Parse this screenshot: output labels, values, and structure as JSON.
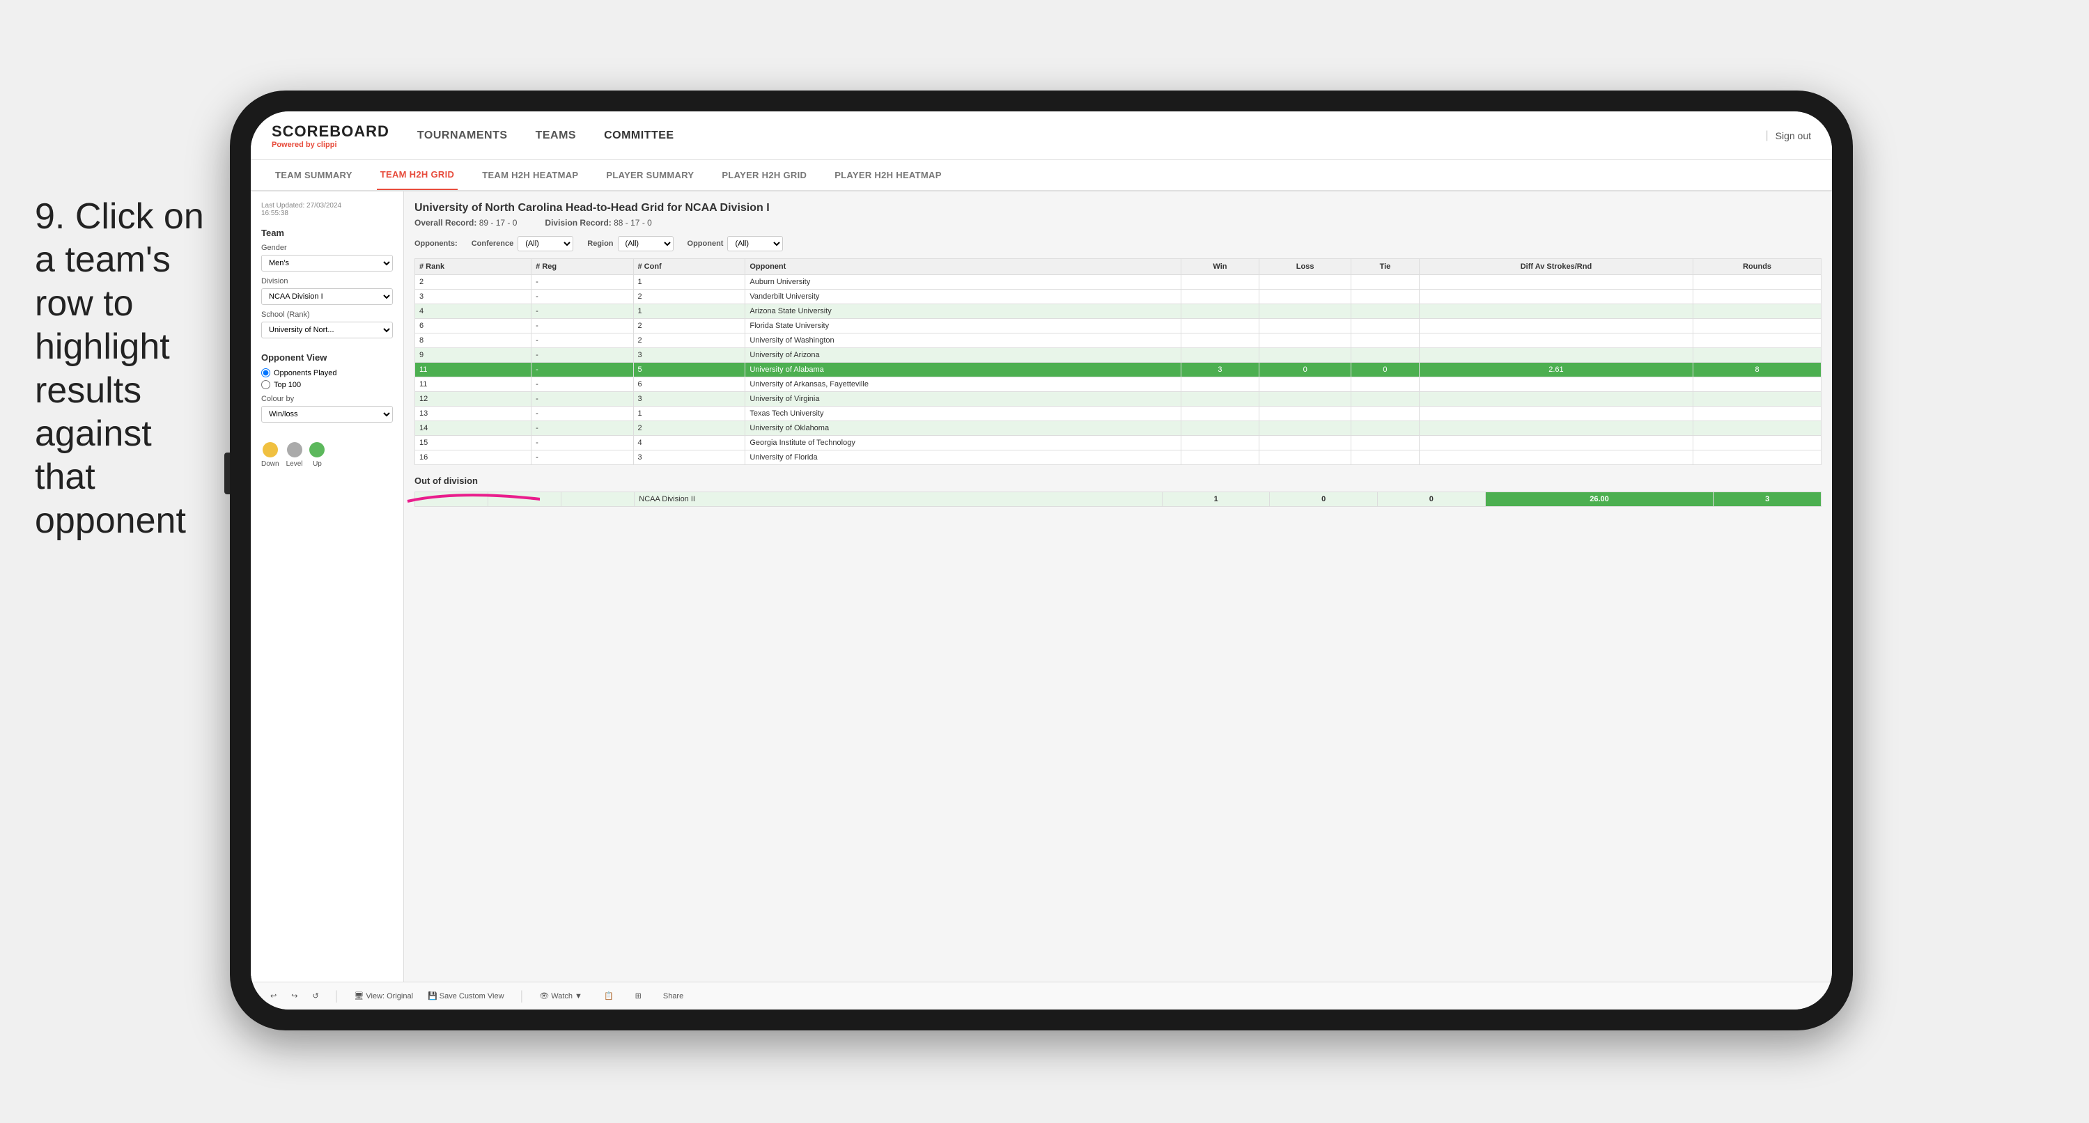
{
  "instruction": {
    "step": "9.",
    "text": "Click on a team's row to highlight results against that opponent"
  },
  "nav": {
    "logo": "SCOREBOARD",
    "powered_by": "Powered by",
    "brand": "clippi",
    "items": [
      "TOURNAMENTS",
      "TEAMS",
      "COMMITTEE"
    ],
    "sign_out": "Sign out"
  },
  "sub_nav": {
    "items": [
      "TEAM SUMMARY",
      "TEAM H2H GRID",
      "TEAM H2H HEATMAP",
      "PLAYER SUMMARY",
      "PLAYER H2H GRID",
      "PLAYER H2H HEATMAP"
    ],
    "active": "TEAM H2H GRID"
  },
  "sidebar": {
    "updated_label": "Last Updated: 27/03/2024",
    "updated_time": "16:55:38",
    "team_label": "Team",
    "gender_label": "Gender",
    "gender_value": "Men's",
    "division_label": "Division",
    "division_value": "NCAA Division I",
    "school_label": "School (Rank)",
    "school_value": "University of Nort...",
    "opponent_view_label": "Opponent View",
    "radio_opponents": "Opponents Played",
    "radio_top100": "Top 100",
    "colour_by_label": "Colour by",
    "colour_by_value": "Win/loss",
    "legend_down": "Down",
    "legend_level": "Level",
    "legend_up": "Up"
  },
  "grid": {
    "title": "University of North Carolina Head-to-Head Grid for NCAA Division I",
    "overall_record_label": "Overall Record:",
    "overall_record": "89 - 17 - 0",
    "division_record_label": "Division Record:",
    "division_record": "88 - 17 - 0",
    "filters": {
      "conference_label": "Conference",
      "conference_value": "(All)",
      "region_label": "Region",
      "region_value": "(All)",
      "opponent_label": "Opponent",
      "opponent_value": "(All)",
      "opponents_label": "Opponents:"
    },
    "columns": [
      "# Rank",
      "# Reg",
      "# Conf",
      "Opponent",
      "Win",
      "Loss",
      "Tie",
      "Diff Av Strokes/Rnd",
      "Rounds"
    ],
    "rows": [
      {
        "rank": "2",
        "reg": "-",
        "conf": "1",
        "opponent": "Auburn University",
        "win": "",
        "loss": "",
        "tie": "",
        "diff": "",
        "rounds": "",
        "style": "normal"
      },
      {
        "rank": "3",
        "reg": "-",
        "conf": "2",
        "opponent": "Vanderbilt University",
        "win": "",
        "loss": "",
        "tie": "",
        "diff": "",
        "rounds": "",
        "style": "normal"
      },
      {
        "rank": "4",
        "reg": "-",
        "conf": "1",
        "opponent": "Arizona State University",
        "win": "",
        "loss": "",
        "tie": "",
        "diff": "",
        "rounds": "",
        "style": "light-green"
      },
      {
        "rank": "6",
        "reg": "-",
        "conf": "2",
        "opponent": "Florida State University",
        "win": "",
        "loss": "",
        "tie": "",
        "diff": "",
        "rounds": "",
        "style": "normal"
      },
      {
        "rank": "8",
        "reg": "-",
        "conf": "2",
        "opponent": "University of Washington",
        "win": "",
        "loss": "",
        "tie": "",
        "diff": "",
        "rounds": "",
        "style": "normal"
      },
      {
        "rank": "9",
        "reg": "-",
        "conf": "3",
        "opponent": "University of Arizona",
        "win": "",
        "loss": "",
        "tie": "",
        "diff": "",
        "rounds": "",
        "style": "light-green"
      },
      {
        "rank": "11",
        "reg": "-",
        "conf": "5",
        "opponent": "University of Alabama",
        "win": "3",
        "loss": "0",
        "tie": "0",
        "diff": "2.61",
        "rounds": "8",
        "style": "highlight"
      },
      {
        "rank": "11",
        "reg": "-",
        "conf": "6",
        "opponent": "University of Arkansas, Fayetteville",
        "win": "",
        "loss": "",
        "tie": "",
        "diff": "",
        "rounds": "",
        "style": "normal"
      },
      {
        "rank": "12",
        "reg": "-",
        "conf": "3",
        "opponent": "University of Virginia",
        "win": "",
        "loss": "",
        "tie": "",
        "diff": "",
        "rounds": "",
        "style": "light-green"
      },
      {
        "rank": "13",
        "reg": "-",
        "conf": "1",
        "opponent": "Texas Tech University",
        "win": "",
        "loss": "",
        "tie": "",
        "diff": "",
        "rounds": "",
        "style": "normal"
      },
      {
        "rank": "14",
        "reg": "-",
        "conf": "2",
        "opponent": "University of Oklahoma",
        "win": "",
        "loss": "",
        "tie": "",
        "diff": "",
        "rounds": "",
        "style": "light-green"
      },
      {
        "rank": "15",
        "reg": "-",
        "conf": "4",
        "opponent": "Georgia Institute of Technology",
        "win": "",
        "loss": "",
        "tie": "",
        "diff": "",
        "rounds": "",
        "style": "normal"
      },
      {
        "rank": "16",
        "reg": "-",
        "conf": "3",
        "opponent": "University of Florida",
        "win": "",
        "loss": "",
        "tie": "",
        "diff": "",
        "rounds": "",
        "style": "normal"
      }
    ],
    "out_of_division_title": "Out of division",
    "out_of_division_rows": [
      {
        "label": "NCAA Division II",
        "win": "1",
        "loss": "0",
        "tie": "0",
        "diff": "26.00",
        "rounds": "3"
      }
    ]
  },
  "toolbar": {
    "buttons": [
      "↩",
      "↪",
      "⟳",
      "⊞",
      "⊠",
      "+",
      "⊡",
      "🕐",
      "View: Original",
      "Save Custom View",
      "👁 Watch ▼",
      "📋",
      "⊞",
      "Share"
    ]
  }
}
